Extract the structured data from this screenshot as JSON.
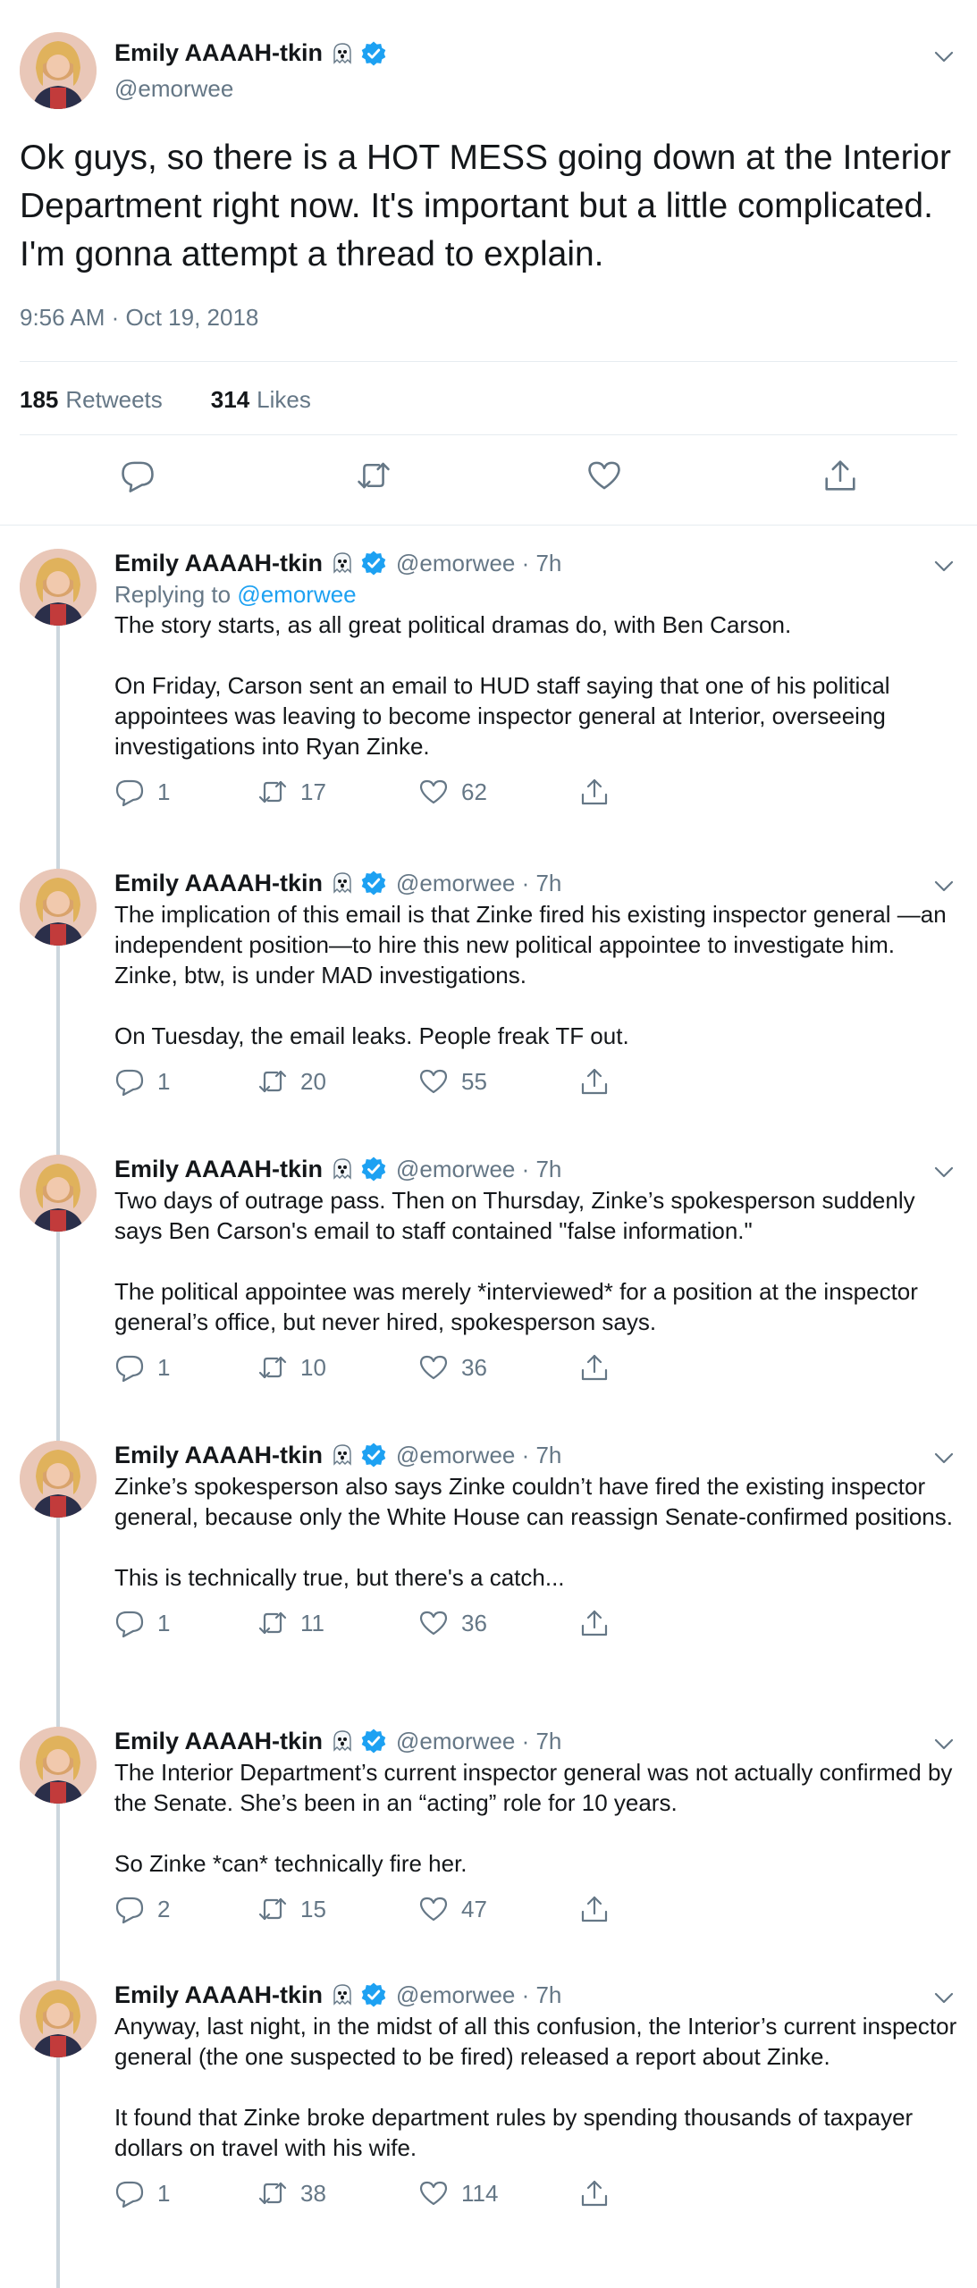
{
  "author": {
    "name": "Emily AAAAH-tkin",
    "handle": "@emorwee"
  },
  "main_tweet": {
    "text": "Ok guys, so there is a HOT MESS going down at the Interior Department right now. It's important but a little complicated. I'm gonna attempt a thread to explain.",
    "timestamp": "9:56 AM · Oct 19, 2018",
    "retweets_count": "185",
    "retweets_label": "Retweets",
    "likes_count": "314",
    "likes_label": "Likes"
  },
  "replies": [
    {
      "name": "Emily AAAAH-tkin",
      "handle_time": "@emorwee · 7h",
      "replying_prefix": "Replying to",
      "replying_to": "@emorwee",
      "text": "The story starts, as all great political dramas do, with Ben Carson.\n\nOn Friday, Carson sent an email to HUD staff saying that one of his political appointees was leaving to become inspector general at Interior, overseeing investigations into Ryan Zinke.",
      "replies": "1",
      "retweets": "17",
      "likes": "62"
    },
    {
      "name": "Emily AAAAH-tkin",
      "handle_time": "@emorwee · 7h",
      "text": "The implication of this email is that Zinke fired his existing inspector general —an independent position—to hire this new political appointee to investigate him. Zinke, btw, is under MAD investigations.\n\nOn Tuesday, the email leaks. People freak TF out.",
      "replies": "1",
      "retweets": "20",
      "likes": "55"
    },
    {
      "name": "Emily AAAAH-tkin",
      "handle_time": "@emorwee · 7h",
      "text": "Two days of outrage pass. Then on Thursday, Zinke’s spokesperson suddenly says Ben Carson's email to staff contained \"false information.\"\n\nThe political appointee was merely *interviewed* for a position at the inspector general’s office, but never hired, spokesperson says.",
      "replies": "1",
      "retweets": "10",
      "likes": "36"
    },
    {
      "name": "Emily AAAAH-tkin",
      "handle_time": "@emorwee · 7h",
      "text": "Zinke’s spokesperson also says Zinke couldn’t have fired the existing inspector general, because only the White House can reassign Senate-confirmed positions.\n\nThis is technically true, but there's a catch...",
      "replies": "1",
      "retweets": "11",
      "likes": "36"
    },
    {
      "name": "Emily AAAAH-tkin",
      "handle_time": "@emorwee · 7h",
      "text": "The Interior Department’s current inspector general was not actually confirmed by the Senate. She’s been in an “acting” role for 10 years.\n\nSo Zinke *can* technically fire her.",
      "replies": "2",
      "retweets": "15",
      "likes": "47"
    },
    {
      "name": "Emily AAAAH-tkin",
      "handle_time": "@emorwee · 7h",
      "text": "Anyway, last night, in the midst of all this confusion, the Interior’s current inspector general (the one suspected to be fired) released a report about Zinke.\n\nIt found that Zinke broke department rules by spending thousands of taxpayer dollars on travel with his wife.",
      "replies": "1",
      "retweets": "38",
      "likes": "114"
    }
  ],
  "colors": {
    "accent": "#1da1f2",
    "secondary_text": "#657786",
    "primary_text": "#14171a",
    "divider": "#e6ecf0",
    "thread_line": "#ccd6dd"
  },
  "icons": [
    "ghost-emoji-icon",
    "verified-badge-icon",
    "chevron-down-icon",
    "reply-icon",
    "retweet-icon",
    "like-icon",
    "share-icon"
  ]
}
